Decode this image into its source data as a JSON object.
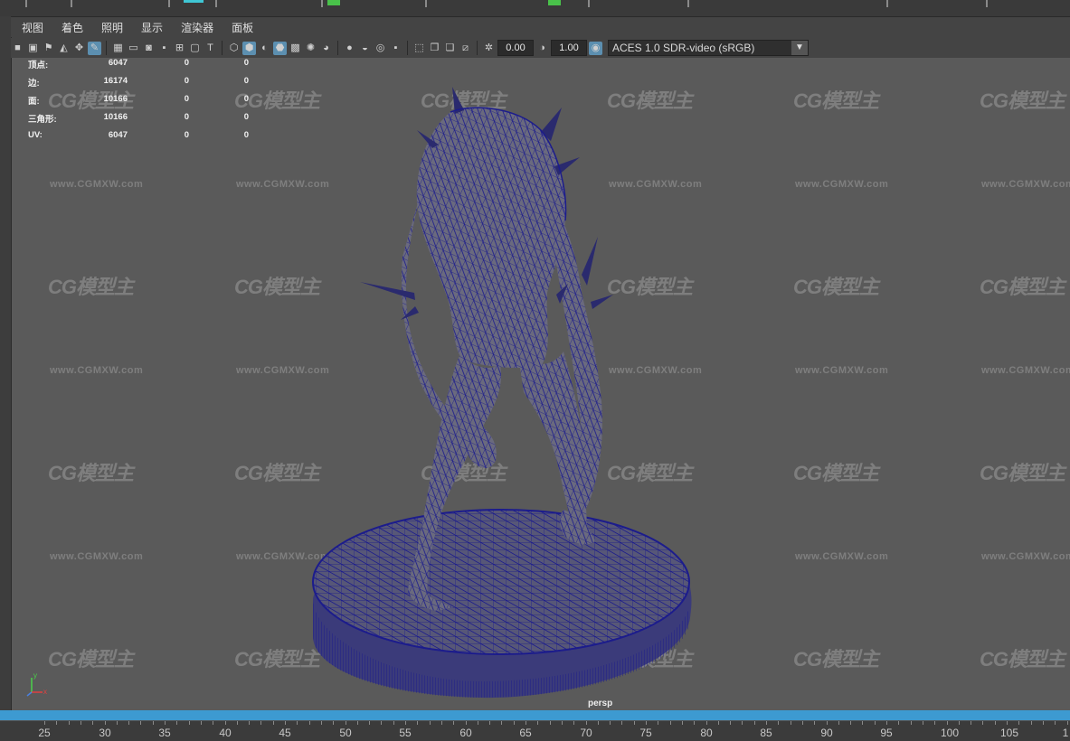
{
  "menu": [
    "视图",
    "着色",
    "照明",
    "显示",
    "渲染器",
    "面板"
  ],
  "toolbar": {
    "exposure": "0.00",
    "gamma": "1.00",
    "color_space": "ACES 1.0 SDR-video (sRGB)"
  },
  "hud": {
    "rows": [
      {
        "label": "顶点:",
        "v1": "6047",
        "v2": "0",
        "v3": "0"
      },
      {
        "label": "边:",
        "v1": "16174",
        "v2": "0",
        "v3": "0"
      },
      {
        "label": "面:",
        "v1": "10166",
        "v2": "0",
        "v3": "0"
      },
      {
        "label": "三角形:",
        "v1": "10166",
        "v2": "0",
        "v3": "0"
      },
      {
        "label": "UV:",
        "v1": "6047",
        "v2": "0",
        "v3": "0"
      }
    ]
  },
  "watermark": {
    "logo": "CG模型主",
    "url": "www.CGMXW.com"
  },
  "viewport": {
    "camera": "persp",
    "axis_y": "y",
    "axis_x": "x"
  },
  "ruler": [
    "25",
    "30",
    "35",
    "40",
    "45",
    "50",
    "55",
    "60",
    "65",
    "70",
    "75",
    "80",
    "85",
    "90",
    "95",
    "100",
    "105",
    "1"
  ],
  "colors": {
    "wireframe": "#1c1c8c",
    "timeline": "#3d9ad1",
    "viewport_bg": "#5a5a5a"
  }
}
